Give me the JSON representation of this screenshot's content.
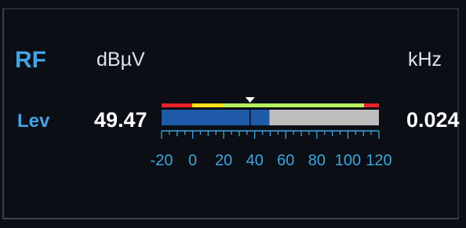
{
  "panel": {
    "section_title": "RF",
    "unit_level": "dBµV",
    "unit_freq": "kHz",
    "row_label": "Lev",
    "level_value": "49.47",
    "freq_value": "0.024"
  },
  "meter": {
    "scale_min": -20,
    "scale_max": 120,
    "level": 49.47,
    "marker": 37,
    "pointer": 37,
    "scale_labels": [
      "-20",
      "0",
      "20",
      "40",
      "60",
      "80",
      "100",
      "120"
    ],
    "band_colors": {
      "low": "#e8212b",
      "mid": "#ffdf1c",
      "good": "#b6f05e",
      "high": "#e8212b"
    },
    "fill_color": "#1f5aa8",
    "remainder_color": "#bdbdbd",
    "pointer_color": "#ffffff"
  }
}
